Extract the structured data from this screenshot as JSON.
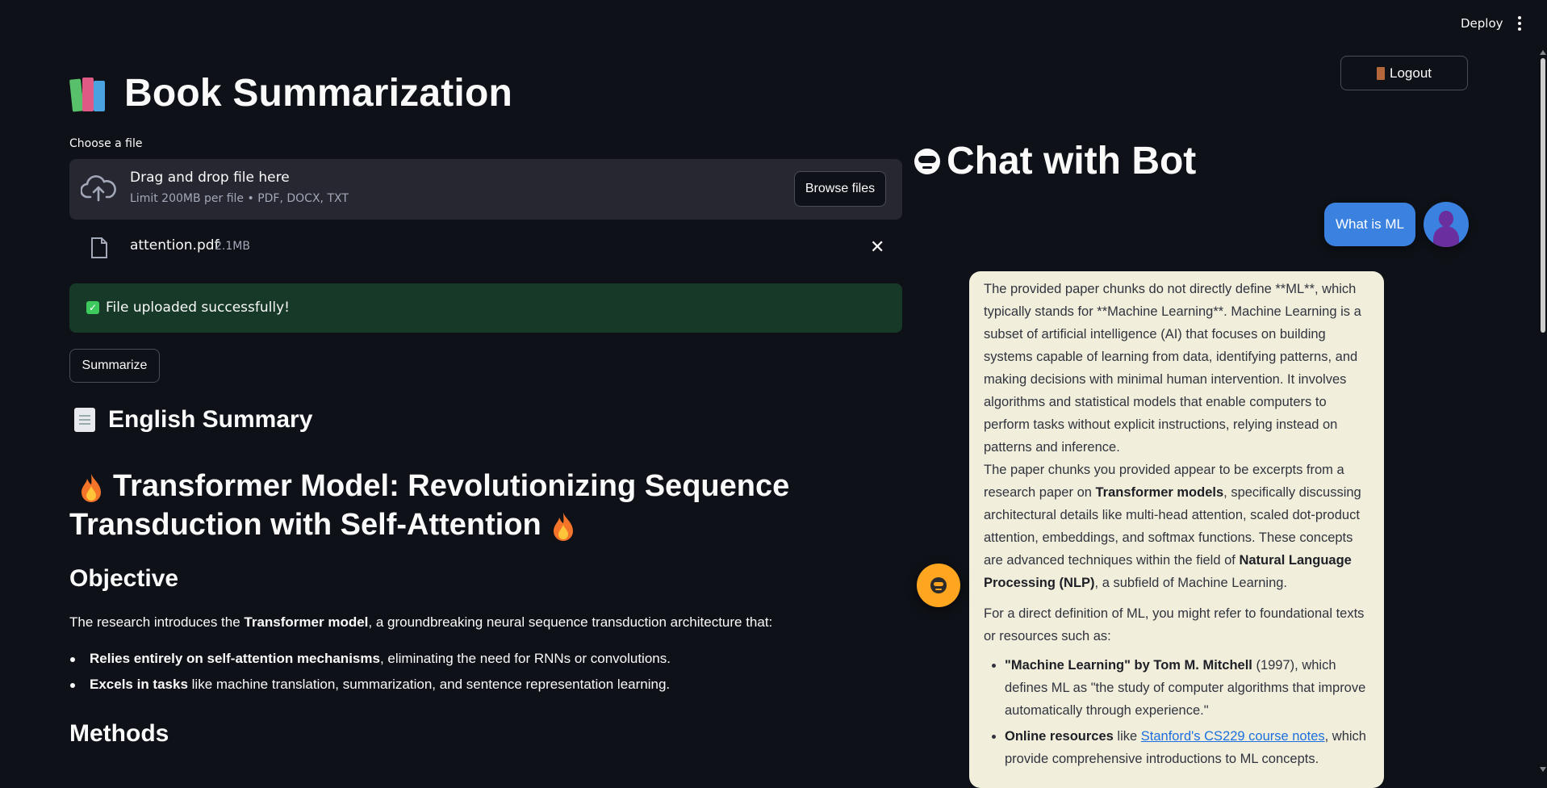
{
  "header": {
    "deploy_label": "Deploy"
  },
  "left": {
    "title": "Book Summarization",
    "uploader": {
      "label": "Choose a file",
      "drop_text": "Drag and drop file here",
      "limit_text": "Limit 200MB per file • PDF, DOCX, TXT",
      "browse_label": "Browse files"
    },
    "file": {
      "name": "attention.pdf",
      "size": "2.1MB"
    },
    "success": {
      "check": "✓",
      "text": "File uploaded successfully!"
    },
    "summarize_label": "Summarize",
    "english_summary": "English Summary",
    "heading": "Transformer Model: Revolutionizing Sequence Transduction with Self-Attention",
    "objective_title": "Objective",
    "objective_intro_pre": "The research introduces the ",
    "objective_intro_bold": "Transformer model",
    "objective_intro_post": ", a groundbreaking neural sequence transduction architecture that:",
    "bullets": [
      {
        "bold": "Relies entirely on self-attention mechanisms",
        "text": ", eliminating the need for RNNs or convolutions."
      },
      {
        "bold": "Excels in tasks",
        "text": " like machine translation, summarization, and sentence representation learning."
      }
    ],
    "methods_title": "Methods"
  },
  "right": {
    "logout_label": "Logout",
    "chat_title": "Chat with Bot",
    "user_message": "What is ML",
    "bot": {
      "p1": "The provided paper chunks do not directly define **ML**, which typically stands for **Machine Learning**. Machine Learning is a subset of artificial intelligence (AI) that focuses on building systems capable of learning from data, identifying patterns, and making decisions with minimal human intervention. It involves algorithms and statistical models that enable computers to perform tasks without explicit instructions, relying instead on patterns and inference.",
      "p2_pre": "The paper chunks you provided appear to be excerpts from a research paper on ",
      "p2_b1": "Transformer models",
      "p2_mid": ", specifically discussing architectural details like multi-head attention, scaled dot-product attention, embeddings, and softmax functions. These concepts are advanced techniques within the field of ",
      "p2_b2": "Natural Language Processing (NLP)",
      "p2_post": ", a subfield of Machine Learning.",
      "p3": "For a direct definition of ML, you might refer to foundational texts or resources such as:",
      "li1_bold": "\"Machine Learning\" by Tom M. Mitchell",
      "li1_text": " (1997), which defines ML as \"the study of computer algorithms that improve automatically through experience.\"",
      "li2_bold": "Online resources",
      "li2_pre": " like ",
      "li2_link": "Stanford's CS229 course notes",
      "li2_post": ", which provide comprehensive introductions to ML concepts."
    }
  },
  "icons": {
    "books": "books-icon",
    "cloud": "cloud-upload-icon",
    "file": "file-icon",
    "close": "close-icon",
    "check": "check-icon",
    "doc": "document-icon",
    "flame": "flame-icon",
    "bot": "bot-icon",
    "door": "door-icon",
    "user": "user-avatar-icon"
  },
  "colors": {
    "background": "#0e1117",
    "dropzone": "#262730",
    "success": "#173928",
    "user_bubble": "#3b82e0",
    "bot_bubble": "#f1efdb",
    "fab": "#ffa51f"
  }
}
